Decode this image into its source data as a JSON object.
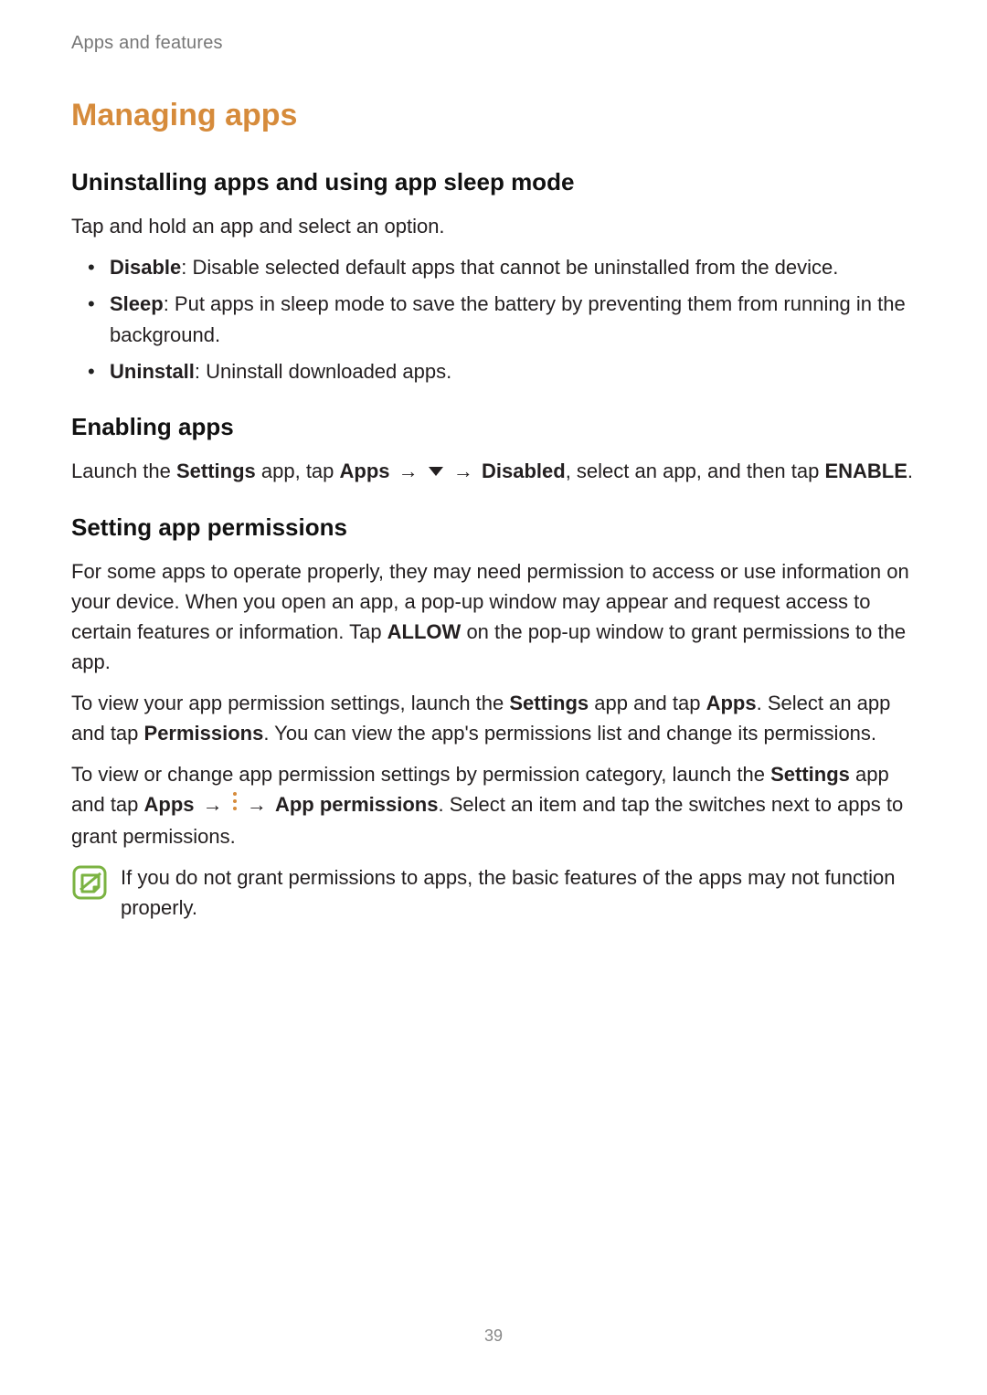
{
  "running_head": "Apps and features",
  "title": "Managing apps",
  "sec1": {
    "heading": "Uninstalling apps and using app sleep mode",
    "intro": "Tap and hold an app and select an option.",
    "items": [
      {
        "label": "Disable",
        "desc": ": Disable selected default apps that cannot be uninstalled from the device."
      },
      {
        "label": "Sleep",
        "desc": ": Put apps in sleep mode to save the battery by preventing them from running in the background."
      },
      {
        "label": "Uninstall",
        "desc": ": Uninstall downloaded apps."
      }
    ]
  },
  "sec2": {
    "heading": "Enabling apps",
    "line_pre": "Launch the ",
    "settings": "Settings",
    "line_mid1": " app, tap ",
    "apps": "Apps",
    "arrow": " → ",
    "disabled": "Disabled",
    "line_mid2": ", select an app, and then tap ",
    "enable": "ENABLE",
    "period": "."
  },
  "sec3": {
    "heading": "Setting app permissions",
    "p1_a": "For some apps to operate properly, they may need permission to access or use information on your device. When you open an app, a pop-up window may appear and request access to certain features or information. Tap ",
    "p1_allow": "ALLOW",
    "p1_b": " on the pop-up window to grant permissions to the app.",
    "p2_a": "To view your app permission settings, launch the ",
    "p2_settings": "Settings",
    "p2_b": " app and tap ",
    "p2_apps": "Apps",
    "p2_c": ". Select an app and tap ",
    "p2_perm": "Permissions",
    "p2_d": ". You can view the app's permissions list and change its permissions.",
    "p3_a": "To view or change app permission settings by permission category, launch the ",
    "p3_settings": "Settings",
    "p3_b": " app and tap ",
    "p3_apps": "Apps",
    "p3_arrow": " → ",
    "p3_appperm": "App permissions",
    "p3_c": ". Select an item and tap the switches next to apps to grant permissions."
  },
  "note": "If you do not grant permissions to apps, the basic features of the apps may not function properly.",
  "page_number": "39"
}
